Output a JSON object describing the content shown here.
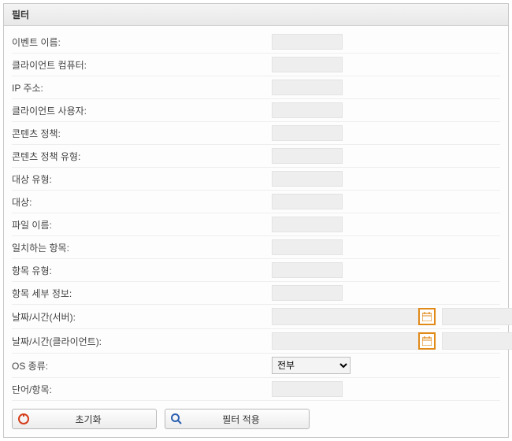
{
  "panel": {
    "title": "필터"
  },
  "fields": {
    "event_name": {
      "label": "이벤트 이름:",
      "value": ""
    },
    "client_computer": {
      "label": "클라이언트 컴퓨터:",
      "value": ""
    },
    "ip_address": {
      "label": "IP 주소:",
      "value": ""
    },
    "client_user": {
      "label": "클라이언트 사용자:",
      "value": ""
    },
    "content_policy": {
      "label": "콘텐츠 정책:",
      "value": ""
    },
    "content_policy_type": {
      "label": "콘텐츠 정책 유형:",
      "value": ""
    },
    "target_type": {
      "label": "대상 유형:",
      "value": ""
    },
    "target": {
      "label": "대상:",
      "value": ""
    },
    "file_name": {
      "label": "파일 이름:",
      "value": ""
    },
    "matching_item": {
      "label": "일치하는 항목:",
      "value": ""
    },
    "item_type": {
      "label": "항목 유형:",
      "value": ""
    },
    "item_detail": {
      "label": "항목 세부 정보:",
      "value": ""
    },
    "datetime_server": {
      "label": "날짜/시간(서버):",
      "from": "",
      "to": ""
    },
    "datetime_client": {
      "label": "날짜/시간(클라이언트):",
      "from": "",
      "to": ""
    },
    "os_type": {
      "label": "OS 종류:",
      "selected": "전부"
    },
    "word_item": {
      "label": "단어/항목:",
      "value": ""
    }
  },
  "buttons": {
    "reset": "초기화",
    "apply": "필터 적용"
  }
}
